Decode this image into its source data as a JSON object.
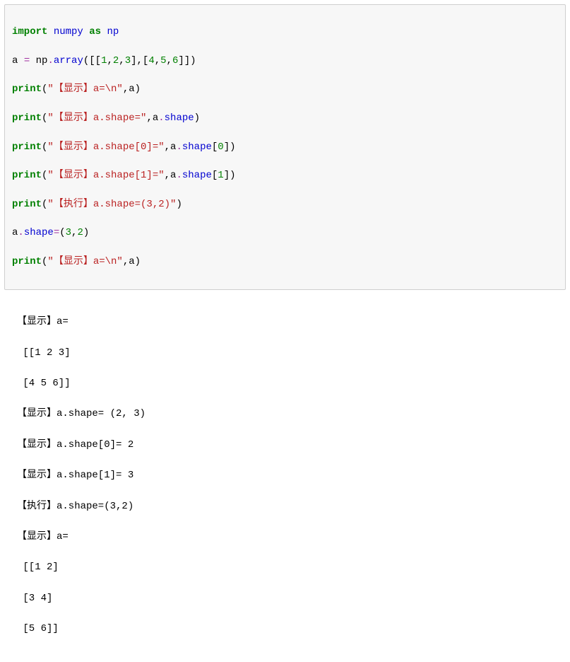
{
  "code": {
    "l1": {
      "import": "import",
      "numpy": "numpy",
      "as": "as",
      "np": "np"
    },
    "l2": {
      "a": "a",
      "eq": "=",
      "np": "np",
      "dot": ".",
      "array": "array",
      "open": "([[",
      "n1": "1",
      "c1": ",",
      "n2": "2",
      "c2": ",",
      "n3": "3",
      "mid": "],[",
      "n4": "4",
      "c4": ",",
      "n5": "5",
      "c5": ",",
      "n6": "6",
      "close": "]])"
    },
    "l3": {
      "print": "print",
      "open": "(",
      "str": "\"【显示】a=\\n\"",
      "comma": ",",
      "a": "a",
      "close": ")"
    },
    "l4": {
      "print": "print",
      "open": "(",
      "str": "\"【显示】a.shape=\"",
      "comma": ",",
      "a": "a",
      "dot": ".",
      "shape": "shape",
      "close": ")"
    },
    "l5": {
      "print": "print",
      "open": "(",
      "str": "\"【显示】a.shape[0]=\"",
      "comma": ",",
      "a": "a",
      "dot": ".",
      "shape": "shape",
      "br": "[",
      "idx": "0",
      "br2": "]",
      "close": ")"
    },
    "l6": {
      "print": "print",
      "open": "(",
      "str": "\"【显示】a.shape[1]=\"",
      "comma": ",",
      "a": "a",
      "dot": ".",
      "shape": "shape",
      "br": "[",
      "idx": "1",
      "br2": "]",
      "close": ")"
    },
    "l7": {
      "print": "print",
      "open": "(",
      "str": "\"【执行】a.shape=(3,2)\"",
      "close": ")"
    },
    "l8": {
      "a": "a",
      "dot": ".",
      "shape": "shape",
      "eq": "=",
      "open": "(",
      "n1": "3",
      "c": ",",
      "n2": "2",
      "close": ")"
    },
    "l9": {
      "print": "print",
      "open": "(",
      "str": "\"【显示】a=\\n\"",
      "comma": ",",
      "a": "a",
      "close": ")"
    }
  },
  "output": {
    "o1": "【显示】a=",
    "o2": " [[1 2 3]",
    "o3": " [4 5 6]]",
    "o4": "【显示】a.shape= (2, 3)",
    "o5": "【显示】a.shape[0]= 2",
    "o6": "【显示】a.shape[1]= 3",
    "o7": "【执行】a.shape=(3,2)",
    "o8": "【显示】a=",
    "o9": " [[1 2]",
    "o10": " [3 4]",
    "o11": " [5 6]]"
  }
}
